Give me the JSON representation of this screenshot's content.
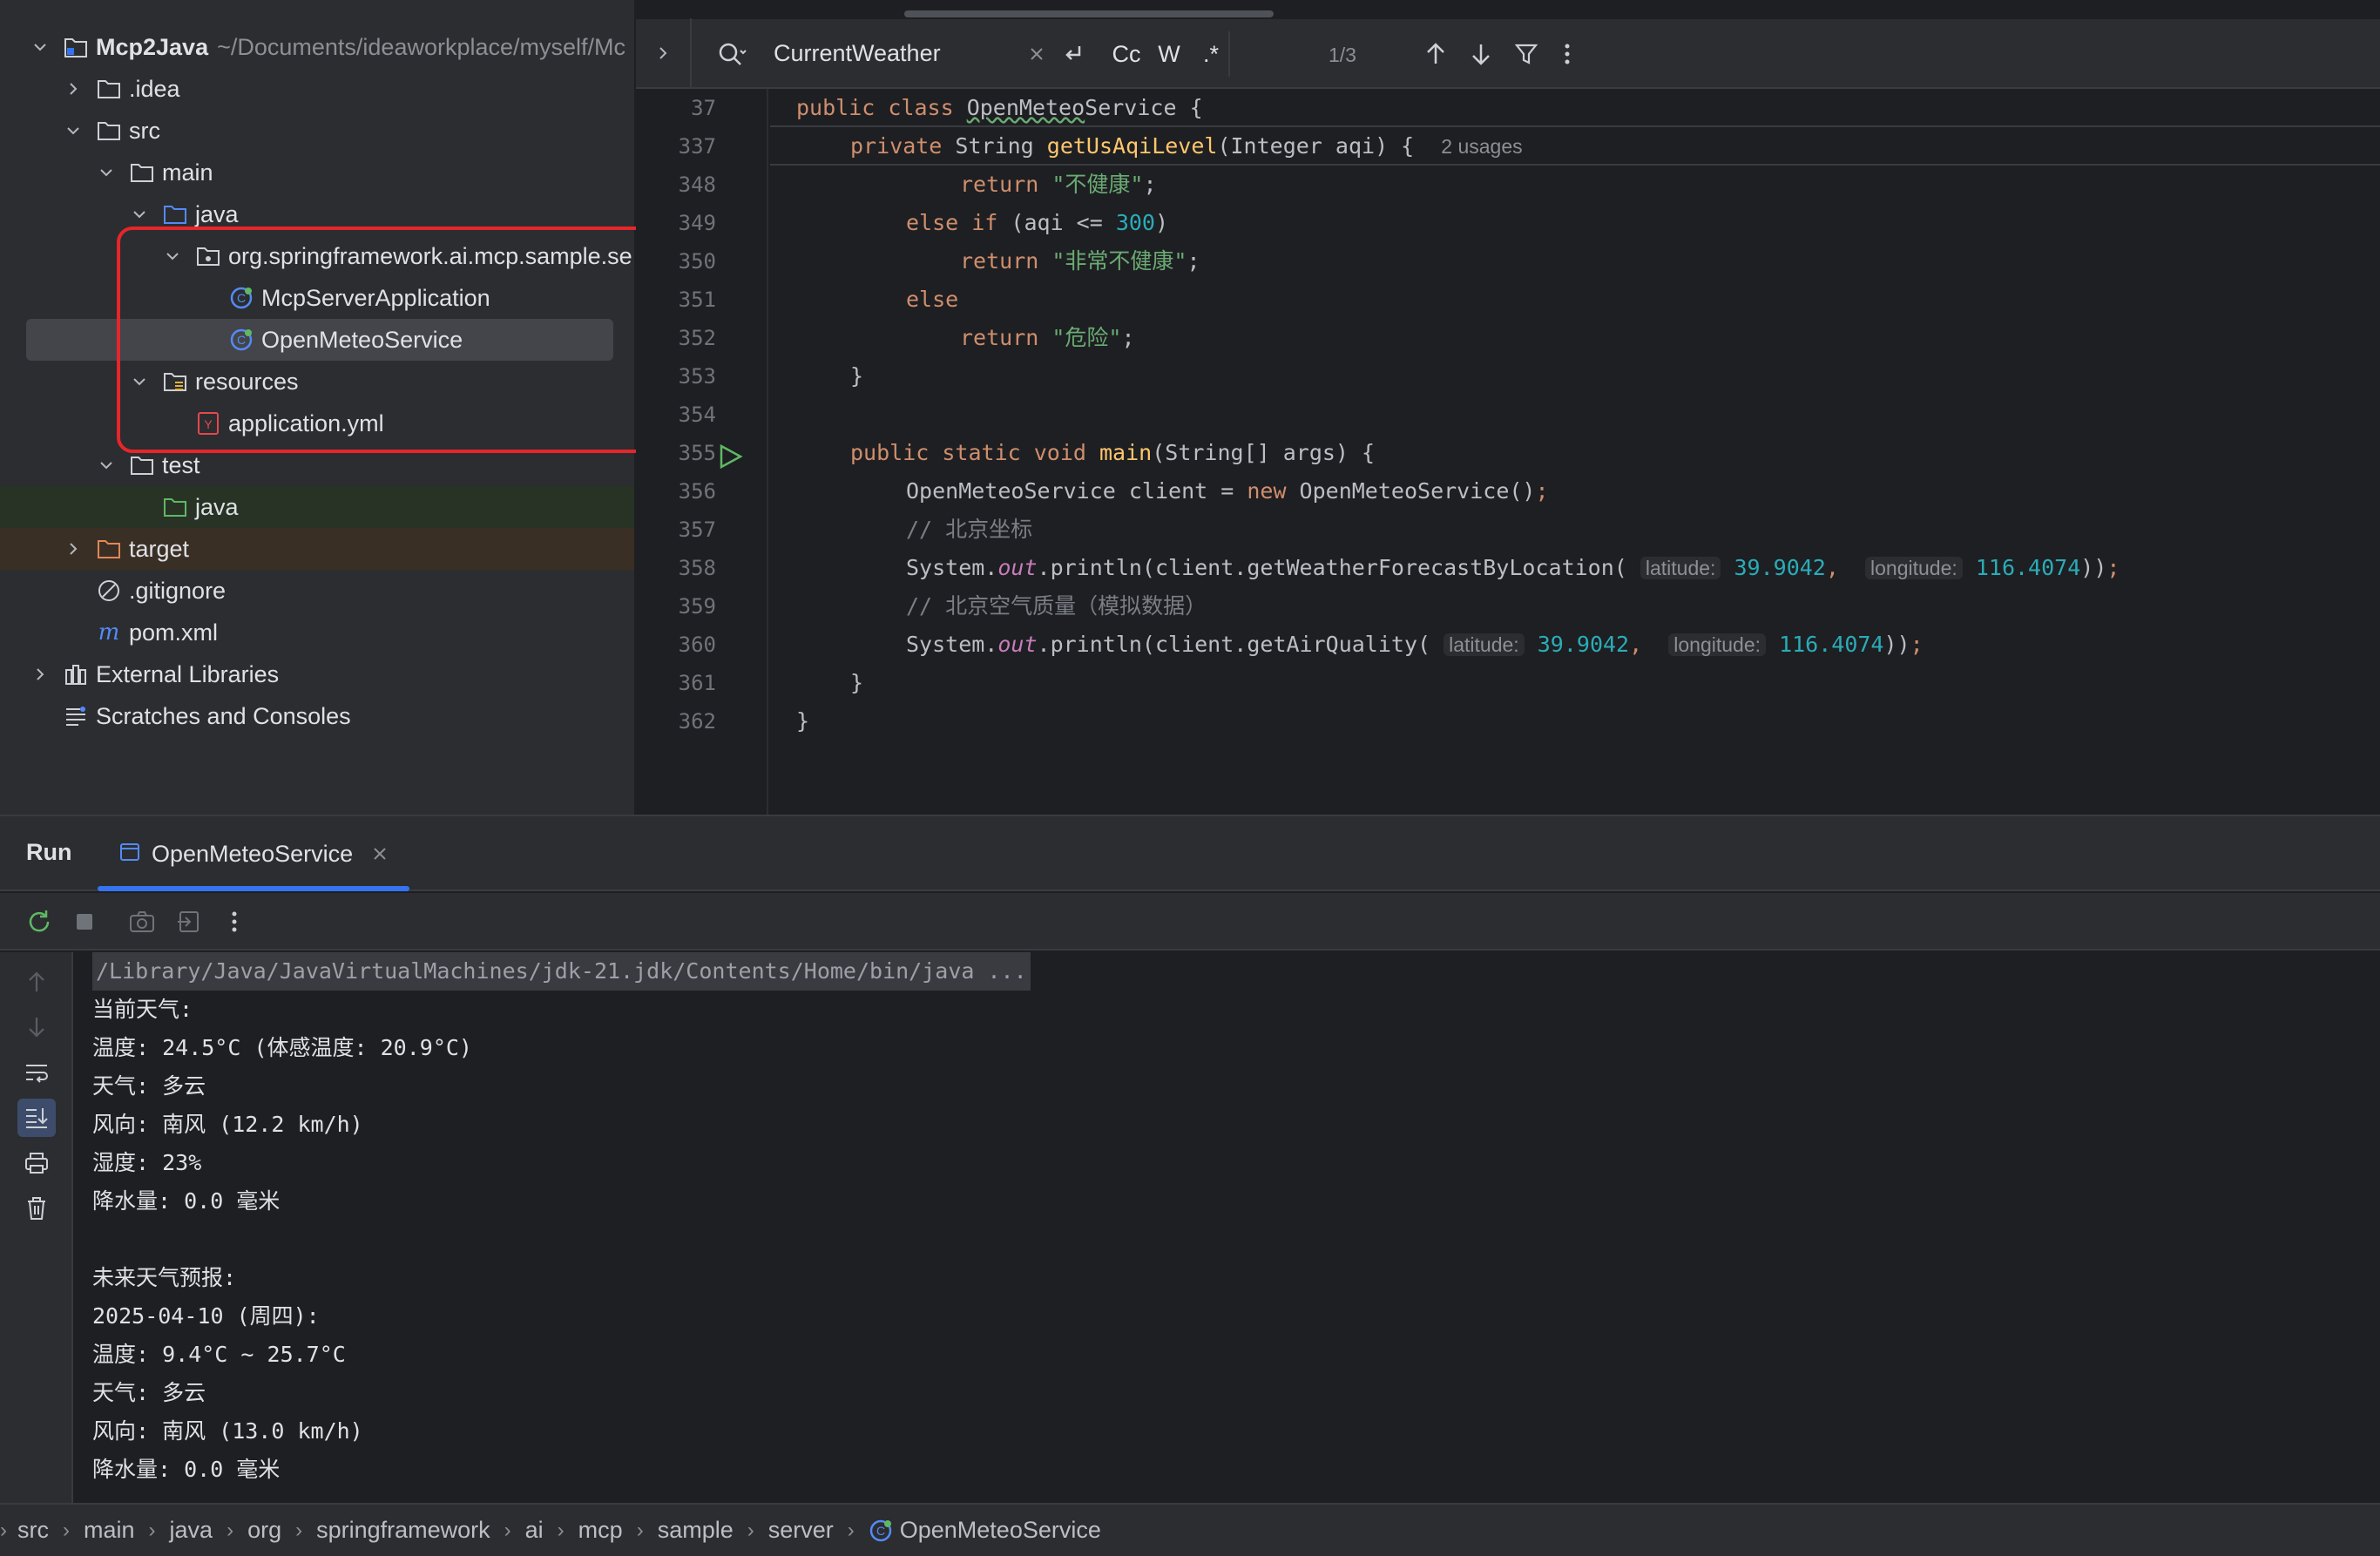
{
  "project": {
    "root": {
      "name": "Mcp2Java",
      "path": "~/Documents/ideaworkplace/myself/Mc"
    },
    "items": [
      {
        "label": ".idea"
      },
      {
        "label": "src"
      },
      {
        "label": "main"
      },
      {
        "label": "java"
      },
      {
        "label": "org.springframework.ai.mcp.sample.se"
      },
      {
        "label": "McpServerApplication"
      },
      {
        "label": "OpenMeteoService"
      },
      {
        "label": "resources"
      },
      {
        "label": "application.yml"
      },
      {
        "label": "test"
      },
      {
        "label": "java"
      },
      {
        "label": "target"
      },
      {
        "label": ".gitignore"
      },
      {
        "label": "pom.xml"
      },
      {
        "label": "External Libraries"
      },
      {
        "label": "Scratches and Consoles"
      }
    ]
  },
  "find": {
    "query": "CurrentWeather",
    "case_label": "Cc",
    "word_label": "W",
    "regex_label": ".*",
    "count": "1/3"
  },
  "code": {
    "line_numbers": [
      "37",
      "337",
      "348",
      "349",
      "350",
      "351",
      "352",
      "353",
      "354",
      "355",
      "356",
      "357",
      "358",
      "359",
      "360",
      "361",
      "362"
    ],
    "usages": "2 usages",
    "strings": {
      "unhealthy": "\"不健康\"",
      "very_unhealthy": "\"非常不健康\"",
      "hazardous": "\"危险\""
    },
    "comments": {
      "beijing_coords": "// 北京坐标",
      "beijing_air": "// 北京空气质量（模拟数据）"
    },
    "hints": {
      "latitude": "latitude:",
      "longitude": "longitude:"
    },
    "numbers": {
      "aqi_limit": "300",
      "lat": "39.9042",
      "lon": "116.4074"
    }
  },
  "run": {
    "title": "Run",
    "tab_label": "OpenMeteoService",
    "output": [
      "/Library/Java/JavaVirtualMachines/jdk-21.jdk/Contents/Home/bin/java ...",
      "当前天气:",
      "温度: 24.5°C (体感温度: 20.9°C)",
      "天气: 多云",
      "风向: 南风 (12.2 km/h)",
      "湿度: 23%",
      "降水量: 0.0 毫米",
      "",
      "未来天气预报:",
      "2025-04-10 (周四):",
      "温度: 9.4°C ~ 25.7°C",
      "天气: 多云",
      "风向: 南风 (13.0 km/h)",
      "降水量: 0.0 毫米"
    ]
  },
  "breadcrumbs": [
    "src",
    "main",
    "java",
    "org",
    "springframework",
    "ai",
    "mcp",
    "sample",
    "server",
    "OpenMeteoService"
  ],
  "colors": {
    "accent": "#3574f0",
    "highlight_box": "#e5262a",
    "run_green": "#5fb865"
  }
}
